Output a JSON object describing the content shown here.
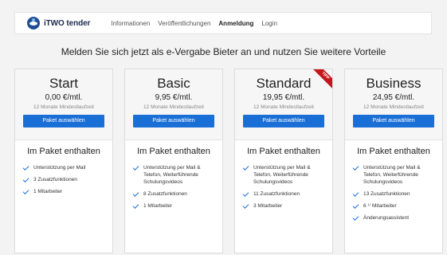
{
  "nav": {
    "brand": "iTWO tender",
    "links": [
      "Informationen",
      "Veröffentlichungen",
      "Anmeldung",
      "Login"
    ]
  },
  "headline": "Melden Sie sich jetzt als e-Vergabe Bieter an und nutzen Sie weitere Vorteile",
  "plans": [
    {
      "name": "Start",
      "price": "0,00 €/mtl.",
      "term": "12 Monate Mindestlaufzeit",
      "button": "Paket auswählen",
      "features_title": "Im Paket enthalten",
      "features": [
        "Unterstützung per Mail",
        "3 Zusatzfunktionen",
        "1 Mitarbeiter"
      ]
    },
    {
      "name": "Basic",
      "price": "9,95 €/mtl.",
      "term": "12 Monate Mindestlaufzeit",
      "button": "Paket auswählen",
      "features_title": "Im Paket enthalten",
      "features": [
        "Unterstützung per Mail & Telefon, Weiterführende Schulungsvideos",
        "8 Zusatzfunktionen",
        "1 Mitarbeiter"
      ]
    },
    {
      "name": "Standard",
      "price": "19,95 €/mtl.",
      "term": "12 Monate Mindestlaufzeit",
      "button": "Paket auswählen",
      "badge": "TIPP",
      "features_title": "Im Paket enthalten",
      "features": [
        "Unterstützung per Mail & Telefon, Weiterführende Schulungsvideos",
        "11 Zusatzfunktionen",
        "3 Mitarbeiter"
      ]
    },
    {
      "name": "Business",
      "price": "24,95 €/mtl.",
      "term": "12 Monate Mindestlaufzeit",
      "button": "Paket auswählen",
      "features_title": "Im Paket enthalten",
      "features": [
        "Unterstützung per Mail & Telefon, Weiterführende Schulungsvideos",
        "13 Zusatzfunktionen",
        "6 ¹⁾ Mitarbeiter",
        "Änderungsassistent"
      ]
    }
  ],
  "colors": {
    "accent": "#1a6fd6",
    "badge": "#c4161c",
    "brand": "#1f4e96"
  }
}
